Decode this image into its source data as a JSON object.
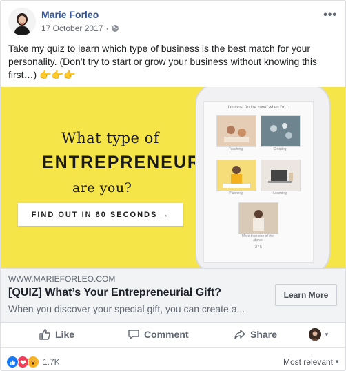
{
  "post": {
    "author": "Marie Forleo",
    "date": "17 October 2017",
    "date_separator": "·",
    "more_icon": "more-horizontal-icon",
    "message": "Take my quiz to learn which type of business is the best match for your personality. (Don’t try to start or grow your business without knowing this first…) 👉👉👉"
  },
  "banner": {
    "line1": "What type of",
    "line2": "ENTREPRENEUR",
    "line3": "are you?",
    "cta": "FIND OUT IN 60 SECONDS →",
    "phone": {
      "title": "I'm most \"in the zone\" when I'm...",
      "options": [
        "Teaching",
        "Creating",
        "Planning",
        "Learning",
        "More than one of the above"
      ],
      "pager": "2 / 5"
    }
  },
  "link_preview": {
    "domain": "WWW.MARIEFORLEO.COM",
    "title": "[QUIZ] What’s Your Entrepreneurial Gift?",
    "description": "When you discover your special gift, you can create a...",
    "button": "Learn More"
  },
  "actions": {
    "like": "Like",
    "comment": "Comment",
    "share": "Share"
  },
  "reactions": {
    "count": "1.7K",
    "sort": "Most relevant",
    "types": [
      "like",
      "love",
      "wow"
    ],
    "colors": {
      "like": "#1877f2",
      "love": "#f33e58",
      "wow": "#f7b125"
    }
  }
}
